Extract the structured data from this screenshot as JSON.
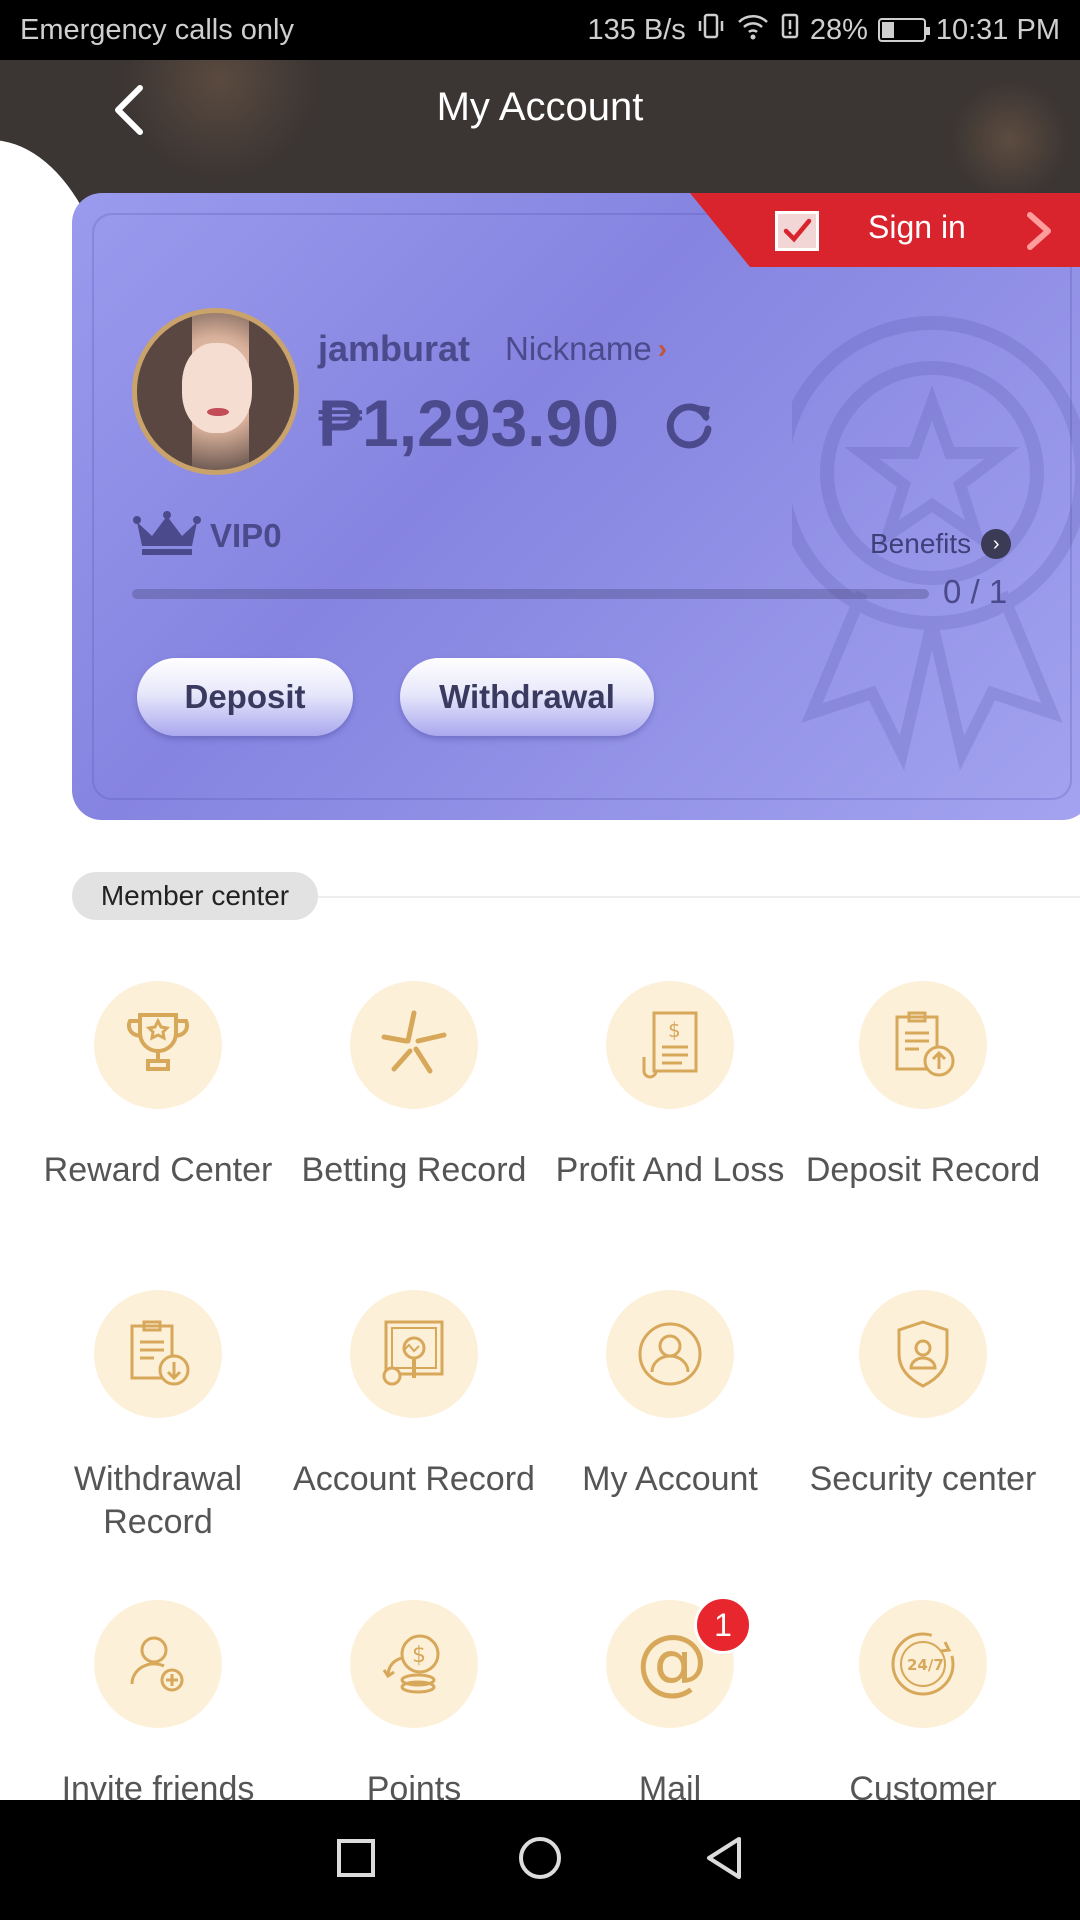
{
  "status_bar": {
    "carrier": "Emergency calls only",
    "speed": "135 B/s",
    "battery": "28%",
    "battery_level": 0.28,
    "time": "10:31 PM"
  },
  "header": {
    "title": "My Account"
  },
  "card": {
    "sign_in_label": "Sign in",
    "username": "jamburat",
    "nickname_label": "Nickname",
    "balance": "₱1,293.90",
    "vip_level": "VIP0",
    "benefits_label": "Benefits",
    "progress_text": "0 / 1",
    "progress_value": 0,
    "deposit_label": "Deposit",
    "withdrawal_label": "Withdrawal"
  },
  "member_center": {
    "title": "Member center",
    "items": [
      {
        "label": "Reward Center",
        "icon": "trophy-icon"
      },
      {
        "label": "Betting Record",
        "icon": "star-burst-icon"
      },
      {
        "label": "Profit And Loss",
        "icon": "receipt-icon"
      },
      {
        "label": "Deposit Record",
        "icon": "clipboard-upload-icon"
      },
      {
        "label": "Withdrawal Record",
        "icon": "clipboard-download-icon"
      },
      {
        "label": "Account Record",
        "icon": "chart-search-icon"
      },
      {
        "label": "My Account",
        "icon": "user-icon"
      },
      {
        "label": "Security center",
        "icon": "shield-user-icon"
      },
      {
        "label": "Invite friends",
        "icon": "add-user-icon"
      },
      {
        "label": "Points",
        "icon": "coins-icon"
      },
      {
        "label": "Mail",
        "icon": "at-mail-icon",
        "badge": "1"
      },
      {
        "label": "Customer",
        "icon": "support-24-7-icon"
      }
    ]
  },
  "colors": {
    "card_accent": "#8584e0",
    "icon_gold": "#d7a85a",
    "icon_bg": "#fdf0d9",
    "sign_in_red": "#d9232d"
  }
}
